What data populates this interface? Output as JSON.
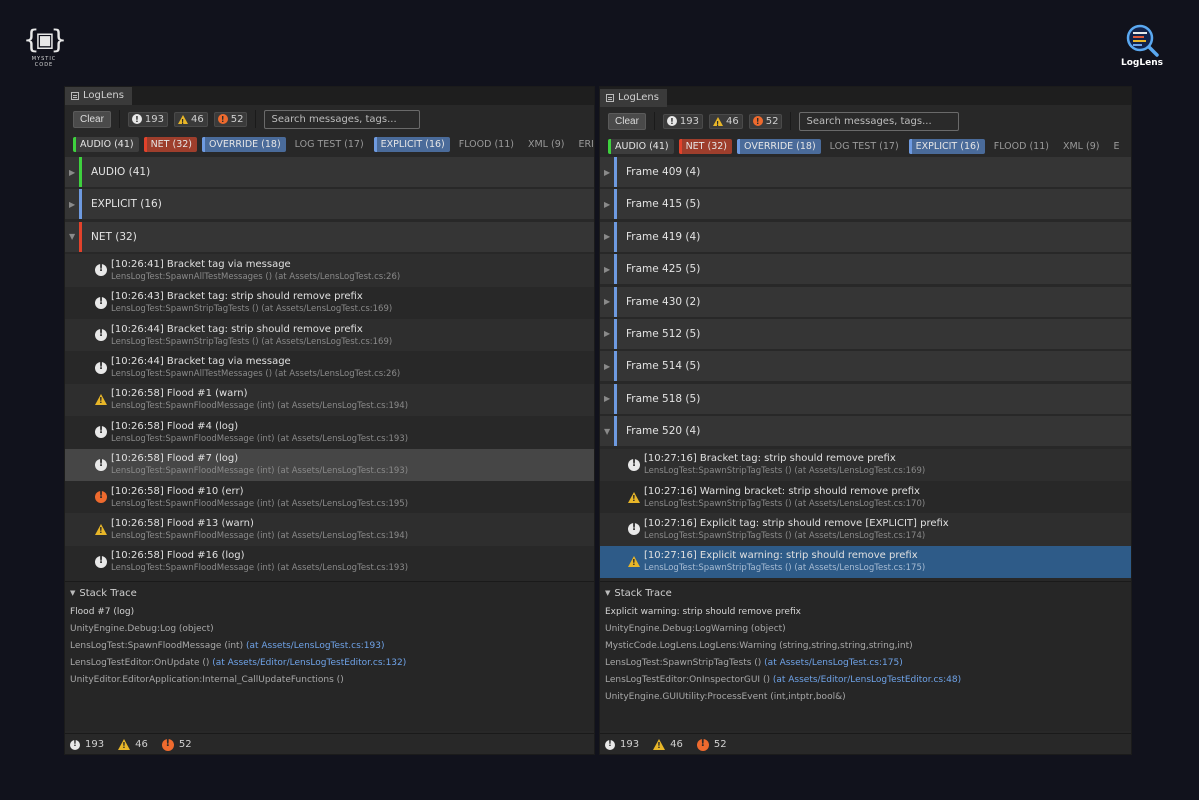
{
  "branding": {
    "left_caption": "MYSTIC CODE",
    "right_label": "LogLens"
  },
  "panels": [
    {
      "tab_title": "LogLens",
      "toolbar": {
        "clear_label": "Clear",
        "log_count": "193",
        "warn_count": "46",
        "err_count": "52",
        "search_placeholder": "Search messages, tags..."
      },
      "chips": [
        {
          "label": "AUDIO (41)",
          "state": "on",
          "kind": "audio"
        },
        {
          "label": "NET (32)",
          "state": "on",
          "kind": "net"
        },
        {
          "label": "OVERRIDE (18)",
          "state": "on",
          "kind": "override"
        },
        {
          "label": "LOG TEST (17)",
          "state": "off",
          "kind": "plain"
        },
        {
          "label": "EXPLICIT (16)",
          "state": "on",
          "kind": "explicit"
        },
        {
          "label": "FLOOD (11)",
          "state": "off",
          "kind": "plain"
        },
        {
          "label": "XML (9)",
          "state": "off",
          "kind": "plain"
        },
        {
          "label": "ERI",
          "state": "off",
          "kind": "plain"
        }
      ],
      "rows": [
        {
          "type": "group",
          "label": "AUDIO (41)",
          "arrow": "▶",
          "color": "#3ed13e"
        },
        {
          "type": "group",
          "label": "EXPLICIT (16)",
          "arrow": "▶",
          "color": "#6e9ae0"
        },
        {
          "type": "group",
          "label": "NET (32)",
          "arrow": "▼",
          "color": "#e2422b"
        },
        {
          "type": "entry",
          "level": "log",
          "bg": "alt",
          "msg": "[10:26:41] Bracket tag via message",
          "src": "LensLogTest:SpawnAllTestMessages () (at Assets/LensLogTest.cs:26)"
        },
        {
          "type": "entry",
          "level": "log",
          "bg": "plain",
          "msg": "[10:26:43] Bracket tag: strip should remove prefix",
          "src": "LensLogTest:SpawnStripTagTests () (at Assets/LensLogTest.cs:169)"
        },
        {
          "type": "entry",
          "level": "log",
          "bg": "alt",
          "msg": "[10:26:44] Bracket tag: strip should remove prefix",
          "src": "LensLogTest:SpawnStripTagTests () (at Assets/LensLogTest.cs:169)"
        },
        {
          "type": "entry",
          "level": "log",
          "bg": "plain",
          "msg": "[10:26:44] Bracket tag via message",
          "src": "LensLogTest:SpawnAllTestMessages () (at Assets/LensLogTest.cs:26)"
        },
        {
          "type": "entry",
          "level": "warn",
          "bg": "alt",
          "msg": "[10:26:58] Flood #1 (warn)",
          "src": "LensLogTest:SpawnFloodMessage (int) (at Assets/LensLogTest.cs:194)"
        },
        {
          "type": "entry",
          "level": "log",
          "bg": "plain",
          "msg": "[10:26:58] Flood #4 (log)",
          "src": "LensLogTest:SpawnFloodMessage (int) (at Assets/LensLogTest.cs:193)"
        },
        {
          "type": "entry",
          "level": "log",
          "bg": "sel",
          "msg": "[10:26:58] Flood #7 (log)",
          "src": "LensLogTest:SpawnFloodMessage (int) (at Assets/LensLogTest.cs:193)"
        },
        {
          "type": "entry",
          "level": "err",
          "bg": "plain",
          "msg": "[10:26:58] Flood #10 (err)",
          "src": "LensLogTest:SpawnFloodMessage (int) (at Assets/LensLogTest.cs:195)"
        },
        {
          "type": "entry",
          "level": "warn",
          "bg": "alt",
          "msg": "[10:26:58] Flood #13 (warn)",
          "src": "LensLogTest:SpawnFloodMessage (int) (at Assets/LensLogTest.cs:194)"
        },
        {
          "type": "entry",
          "level": "log",
          "bg": "plain",
          "msg": "[10:26:58] Flood #16 (log)",
          "src": "LensLogTest:SpawnFloodMessage (int) (at Assets/LensLogTest.cs:193)"
        }
      ],
      "stack": {
        "header": "Stack Trace",
        "title": "Flood #7 (log)",
        "frames": [
          {
            "text": "UnityEngine.Debug:Log (object)",
            "link": ""
          },
          {
            "text": "LensLogTest:SpawnFloodMessage (int) ",
            "link": "(at Assets/LensLogTest.cs:193)"
          },
          {
            "text": "LensLogTestEditor:OnUpdate () ",
            "link": "(at Assets/Editor/LensLogTestEditor.cs:132)"
          },
          {
            "text": "UnityEditor.EditorApplication:Internal_CallUpdateFunctions ()",
            "link": ""
          }
        ]
      },
      "status": {
        "log": "193",
        "warn": "46",
        "err": "52"
      }
    },
    {
      "tab_title": "LogLens",
      "toolbar": {
        "clear_label": "Clear",
        "log_count": "193",
        "warn_count": "46",
        "err_count": "52",
        "search_placeholder": "Search messages, tags..."
      },
      "chips": [
        {
          "label": "AUDIO (41)",
          "state": "on",
          "kind": "audio"
        },
        {
          "label": "NET (32)",
          "state": "on",
          "kind": "net"
        },
        {
          "label": "OVERRIDE (18)",
          "state": "on",
          "kind": "override"
        },
        {
          "label": "LOG TEST (17)",
          "state": "off",
          "kind": "plain"
        },
        {
          "label": "EXPLICIT (16)",
          "state": "on",
          "kind": "explicit"
        },
        {
          "label": "FLOOD (11)",
          "state": "off",
          "kind": "plain"
        },
        {
          "label": "XML (9)",
          "state": "off",
          "kind": "plain"
        },
        {
          "label": "E",
          "state": "off",
          "kind": "plain"
        }
      ],
      "rows": [
        {
          "type": "group",
          "label": "Frame 409 (4)",
          "arrow": "▶",
          "color": "#6e9ae0"
        },
        {
          "type": "group",
          "label": "Frame 415 (5)",
          "arrow": "▶",
          "color": "#6e9ae0"
        },
        {
          "type": "group",
          "label": "Frame 419 (4)",
          "arrow": "▶",
          "color": "#6e9ae0"
        },
        {
          "type": "group",
          "label": "Frame 425 (5)",
          "arrow": "▶",
          "color": "#6e9ae0"
        },
        {
          "type": "group",
          "label": "Frame 430 (2)",
          "arrow": "▶",
          "color": "#6e9ae0"
        },
        {
          "type": "group",
          "label": "Frame 512 (5)",
          "arrow": "▶",
          "color": "#6e9ae0"
        },
        {
          "type": "group",
          "label": "Frame 514 (5)",
          "arrow": "▶",
          "color": "#6e9ae0"
        },
        {
          "type": "group",
          "label": "Frame 518 (5)",
          "arrow": "▶",
          "color": "#6e9ae0"
        },
        {
          "type": "group",
          "label": "Frame 520 (4)",
          "arrow": "▼",
          "color": "#6e9ae0"
        },
        {
          "type": "entry",
          "level": "log",
          "bg": "alt",
          "msg": "[10:27:16] Bracket tag: strip should remove prefix",
          "src": "LensLogTest:SpawnStripTagTests () (at Assets/LensLogTest.cs:169)"
        },
        {
          "type": "entry",
          "level": "warn",
          "bg": "plain",
          "msg": "[10:27:16] Warning bracket: strip should remove prefix",
          "src": "LensLogTest:SpawnStripTagTests () (at Assets/LensLogTest.cs:170)"
        },
        {
          "type": "entry",
          "level": "log",
          "bg": "alt",
          "msg": "[10:27:16] Explicit tag: strip should remove [EXPLICIT] prefix",
          "src": "LensLogTest:SpawnStripTagTests () (at Assets/LensLogTest.cs:174)"
        },
        {
          "type": "entry",
          "level": "warn",
          "bg": "selblue",
          "msg": "[10:27:16] Explicit warning: strip should remove prefix",
          "src": "LensLogTest:SpawnStripTagTests () (at Assets/LensLogTest.cs:175)"
        }
      ],
      "stack": {
        "header": "Stack Trace",
        "title": "Explicit warning: strip should remove prefix",
        "frames": [
          {
            "text": "UnityEngine.Debug:LogWarning (object)",
            "link": ""
          },
          {
            "text": "MysticCode.LogLens.LogLens:Warning (string,string,string,string,int)",
            "link": ""
          },
          {
            "text": "LensLogTest:SpawnStripTagTests () ",
            "link": "(at Assets/LensLogTest.cs:175)"
          },
          {
            "text": "LensLogTestEditor:OnInspectorGUI () ",
            "link": "(at Assets/Editor/LensLogTestEditor.cs:48)"
          },
          {
            "text": "UnityEngine.GUIUtility:ProcessEvent (int,intptr,bool&)",
            "link": ""
          }
        ]
      },
      "status": {
        "log": "193",
        "warn": "46",
        "err": "52"
      }
    }
  ]
}
